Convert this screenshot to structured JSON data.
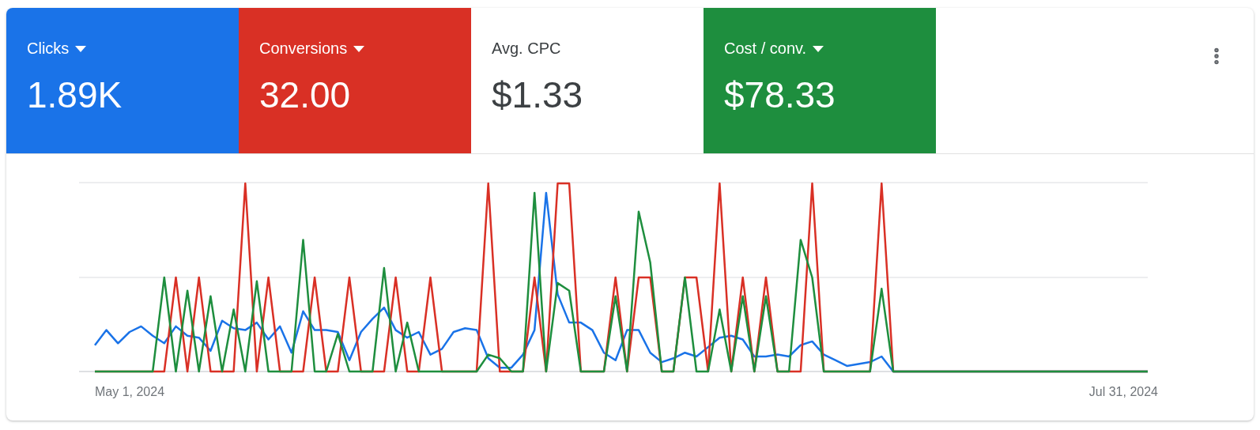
{
  "metrics": [
    {
      "label": "Clicks",
      "value": "1.89K",
      "selected": true,
      "color": "#1a73e8"
    },
    {
      "label": "Conversions",
      "value": "32.00",
      "selected": true,
      "color": "#d93025"
    },
    {
      "label": "Avg. CPC",
      "value": "$1.33",
      "selected": false,
      "color": "#3c4043"
    },
    {
      "label": "Cost / conv.",
      "value": "$78.33",
      "selected": true,
      "color": "#1e8e3e"
    }
  ],
  "chart": {
    "start_label": "May 1, 2024",
    "end_label": "Jul 31, 2024"
  }
}
